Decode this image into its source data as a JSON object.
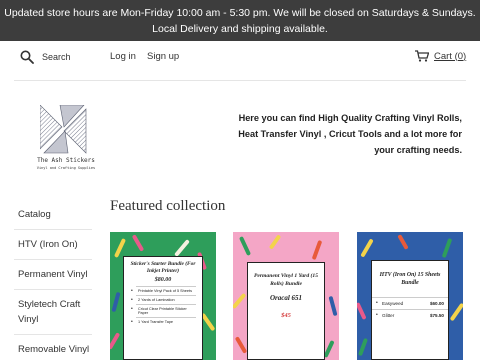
{
  "banner": {
    "text": "Updated store hours are Mon-Friday 10:00 am - 5:30 pm. We will be closed on Saturdays & Sundays. Local Delivery and shipping available."
  },
  "header": {
    "search_placeholder": "Search",
    "login_label": "Log in",
    "signup_label": "Sign up",
    "cart_label": "Cart (0)"
  },
  "logo": {
    "title": "The Ash Stickers",
    "subtitle": "Vinyl and Crafting Supplies"
  },
  "tagline": "Here you can find High Quality Crafting Vinyl Rolls, Heat Transfer Vinyl , Cricut Tools and a lot more for your crafting needs.",
  "sidebar": {
    "items": [
      {
        "label": "Catalog"
      },
      {
        "label": "HTV (Iron On)"
      },
      {
        "label": "Permanent Vinyl"
      },
      {
        "label": "Styletech Craft Vinyl"
      },
      {
        "label": "Removable Vinyl"
      }
    ]
  },
  "featured": {
    "title": "Featured collection",
    "products": [
      {
        "card_title": "Sticker's Starter Bundle (For Inkjet Printer)",
        "price": "$80.00",
        "items": [
          "Printable Vinyl Pack of 5 Sheets",
          "2 Yards of Lamination",
          "Cricut Clear Printable Sticker Paper",
          "1 Yard Transfer Tape"
        ],
        "background": "#2e9e5b"
      },
      {
        "card_title": "Permanent Vinyl 1 Yard (15 Rolls) Bundle",
        "subtitle": "Oracal 651",
        "price": "$45",
        "background": "#f4a6c6"
      },
      {
        "card_title": "HTV (Iron On) 15 Sheets Bundle",
        "rows": [
          {
            "name": "Easyweed",
            "price": "$60.00"
          },
          {
            "name": "Glitter",
            "price": "$75.50"
          }
        ],
        "background": "#2f5ea8"
      }
    ]
  },
  "colors": {
    "banner_bg": "#3d3d3d",
    "price_red": "#d63f3f"
  }
}
